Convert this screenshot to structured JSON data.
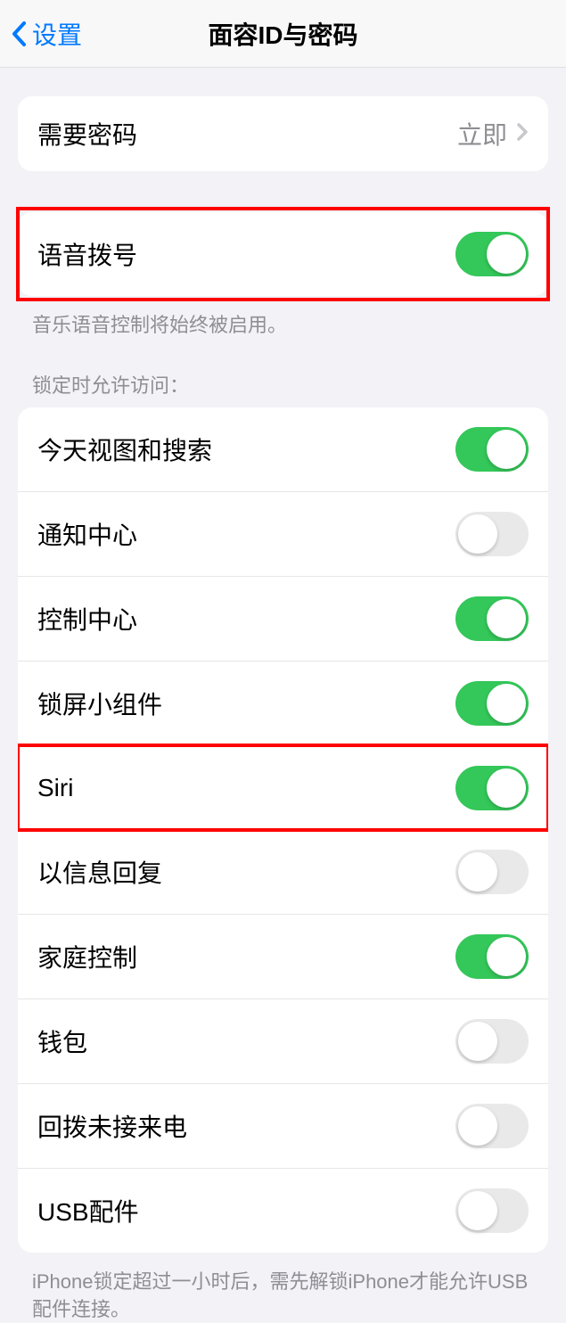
{
  "header": {
    "back_label": "设置",
    "title": "面容ID与密码"
  },
  "passcode_require": {
    "label": "需要密码",
    "value": "立即"
  },
  "voice_dial": {
    "label": "语音拨号",
    "note": "音乐语音控制将始终被启用。",
    "on": true
  },
  "locked_access": {
    "header": "锁定时允许访问：",
    "items": [
      {
        "label": "今天视图和搜索",
        "on": true
      },
      {
        "label": "通知中心",
        "on": false
      },
      {
        "label": "控制中心",
        "on": true
      },
      {
        "label": "锁屏小组件",
        "on": true
      },
      {
        "label": "Siri",
        "on": true
      },
      {
        "label": "以信息回复",
        "on": false
      },
      {
        "label": "家庭控制",
        "on": true
      },
      {
        "label": "钱包",
        "on": false
      },
      {
        "label": "回拨未接来电",
        "on": false
      },
      {
        "label": "USB配件",
        "on": false
      }
    ],
    "footer": "iPhone锁定超过一小时后，需先解锁iPhone才能允许USB配件连接。"
  }
}
